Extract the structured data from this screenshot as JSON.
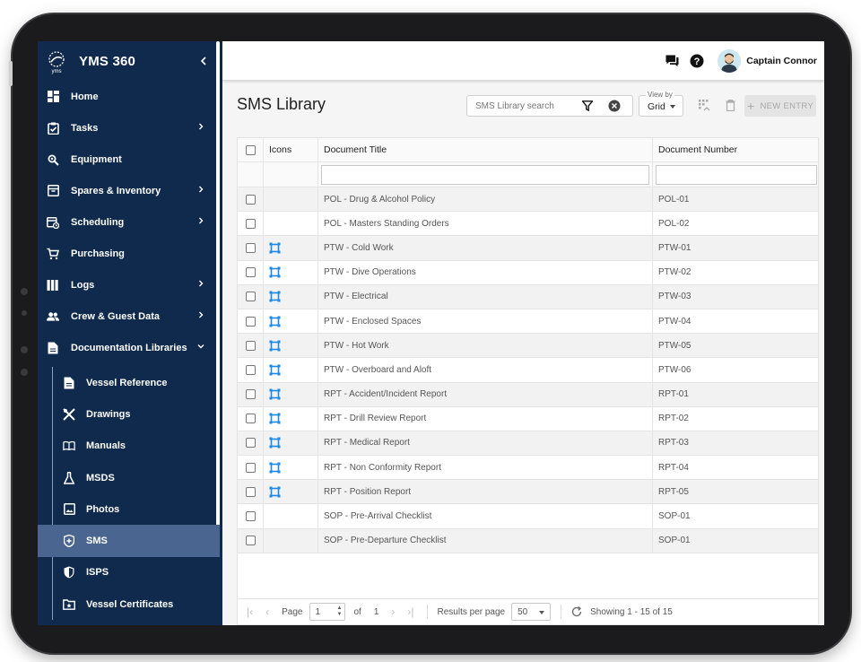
{
  "app": {
    "name": "YMS 360"
  },
  "sidebar": {
    "items": [
      {
        "label": "Home",
        "icon": "dashboard-icon",
        "has_children": false
      },
      {
        "label": "Tasks",
        "icon": "clipboard-check-icon",
        "has_children": true
      },
      {
        "label": "Equipment",
        "icon": "wrench-gear-icon",
        "has_children": false
      },
      {
        "label": "Spares & Inventory",
        "icon": "archive-box-icon",
        "has_children": true
      },
      {
        "label": "Scheduling",
        "icon": "calendar-clock-icon",
        "has_children": true
      },
      {
        "label": "Purchasing",
        "icon": "cart-icon",
        "has_children": false
      },
      {
        "label": "Logs",
        "icon": "books-icon",
        "has_children": true
      },
      {
        "label": "Crew & Guest Data",
        "icon": "people-icon",
        "has_children": true
      },
      {
        "label": "Documentation Libraries",
        "icon": "document-icon",
        "has_children": true,
        "expanded": true
      }
    ],
    "sub_items": [
      {
        "label": "Vessel Reference",
        "icon": "file-text-icon"
      },
      {
        "label": "Drawings",
        "icon": "drafting-tools-icon"
      },
      {
        "label": "Manuals",
        "icon": "open-book-icon"
      },
      {
        "label": "MSDS",
        "icon": "flask-icon"
      },
      {
        "label": "Photos",
        "icon": "image-icon"
      },
      {
        "label": "SMS",
        "icon": "shield-plus-icon",
        "active": true
      },
      {
        "label": "ISPS",
        "icon": "shield-half-icon"
      },
      {
        "label": "Vessel Certificates",
        "icon": "folder-star-icon"
      }
    ]
  },
  "topbar": {
    "user_name": "Captain Connor",
    "icons": [
      "chat-icon",
      "help-icon"
    ]
  },
  "page": {
    "title": "SMS Library",
    "search_placeholder": "SMS Library search",
    "view_by_label": "View by",
    "view_by_value": "Grid",
    "new_entry_label": "NEW ENTRY"
  },
  "grid": {
    "columns": [
      "Icons",
      "Document Title",
      "Document Number"
    ],
    "rows": [
      {
        "title": "POL - Drug & Alcohol Policy",
        "number": "POL-01",
        "has_icon": false
      },
      {
        "title": "POL - Masters Standing Orders",
        "number": "POL-02",
        "has_icon": false
      },
      {
        "title": "PTW - Cold Work",
        "number": "PTW-01",
        "has_icon": true
      },
      {
        "title": "PTW - Dive Operations",
        "number": "PTW-02",
        "has_icon": true
      },
      {
        "title": "PTW - Electrical",
        "number": "PTW-03",
        "has_icon": true
      },
      {
        "title": "PTW - Enclosed Spaces",
        "number": "PTW-04",
        "has_icon": true
      },
      {
        "title": "PTW - Hot Work",
        "number": "PTW-05",
        "has_icon": true
      },
      {
        "title": "PTW - Overboard and Aloft",
        "number": "PTW-06",
        "has_icon": true
      },
      {
        "title": "RPT - Accident/Incident Report",
        "number": "RPT-01",
        "has_icon": true
      },
      {
        "title": "RPT - Drill Review Report",
        "number": "RPT-02",
        "has_icon": true
      },
      {
        "title": "RPT - Medical Report",
        "number": "RPT-03",
        "has_icon": true
      },
      {
        "title": "RPT - Non Conformity Report",
        "number": "RPT-04",
        "has_icon": true
      },
      {
        "title": "RPT - Position Report",
        "number": "RPT-05",
        "has_icon": true
      },
      {
        "title": "SOP - Pre-Arrival Checklist",
        "number": "SOP-01",
        "has_icon": false
      },
      {
        "title": "SOP - Pre-Departure Checklist",
        "number": "SOP-01",
        "has_icon": false
      }
    ]
  },
  "pager": {
    "page_label": "Page",
    "page_value": "1",
    "of_label": "of",
    "total_pages": "1",
    "results_label": "Results per page",
    "results_value": "50",
    "showing": "Showing 1 - 15 of 15"
  },
  "colors": {
    "sidebar_bg": "#0f2a4d",
    "active_item": "#4a6690",
    "row_icon": "#1e88e5"
  }
}
